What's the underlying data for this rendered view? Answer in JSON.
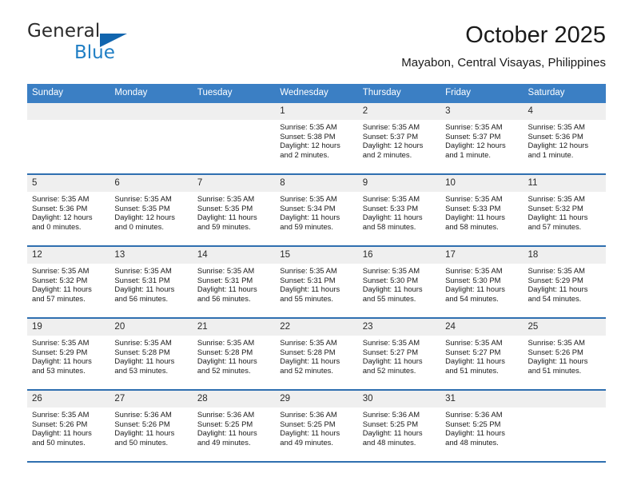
{
  "logo": {
    "word1": "General",
    "word2": "Blue",
    "triangle_color": "#1165ae",
    "blue_color": "#1f7ec4"
  },
  "header": {
    "title": "October 2025",
    "subtitle": "Mayabon, Central Visayas, Philippines"
  },
  "theme": {
    "header_blue": "#3b7fc4",
    "row_divider_blue": "#2f6fb0",
    "date_band_gray": "#efefef"
  },
  "weekdays": [
    "Sunday",
    "Monday",
    "Tuesday",
    "Wednesday",
    "Thursday",
    "Friday",
    "Saturday"
  ],
  "weeks": [
    [
      {
        "day": "",
        "lines": []
      },
      {
        "day": "",
        "lines": []
      },
      {
        "day": "",
        "lines": []
      },
      {
        "day": "1",
        "lines": [
          "Sunrise: 5:35 AM",
          "Sunset: 5:38 PM",
          "Daylight: 12 hours",
          "and 2 minutes."
        ]
      },
      {
        "day": "2",
        "lines": [
          "Sunrise: 5:35 AM",
          "Sunset: 5:37 PM",
          "Daylight: 12 hours",
          "and 2 minutes."
        ]
      },
      {
        "day": "3",
        "lines": [
          "Sunrise: 5:35 AM",
          "Sunset: 5:37 PM",
          "Daylight: 12 hours",
          "and 1 minute."
        ]
      },
      {
        "day": "4",
        "lines": [
          "Sunrise: 5:35 AM",
          "Sunset: 5:36 PM",
          "Daylight: 12 hours",
          "and 1 minute."
        ]
      }
    ],
    [
      {
        "day": "5",
        "lines": [
          "Sunrise: 5:35 AM",
          "Sunset: 5:36 PM",
          "Daylight: 12 hours",
          "and 0 minutes."
        ]
      },
      {
        "day": "6",
        "lines": [
          "Sunrise: 5:35 AM",
          "Sunset: 5:35 PM",
          "Daylight: 12 hours",
          "and 0 minutes."
        ]
      },
      {
        "day": "7",
        "lines": [
          "Sunrise: 5:35 AM",
          "Sunset: 5:35 PM",
          "Daylight: 11 hours",
          "and 59 minutes."
        ]
      },
      {
        "day": "8",
        "lines": [
          "Sunrise: 5:35 AM",
          "Sunset: 5:34 PM",
          "Daylight: 11 hours",
          "and 59 minutes."
        ]
      },
      {
        "day": "9",
        "lines": [
          "Sunrise: 5:35 AM",
          "Sunset: 5:33 PM",
          "Daylight: 11 hours",
          "and 58 minutes."
        ]
      },
      {
        "day": "10",
        "lines": [
          "Sunrise: 5:35 AM",
          "Sunset: 5:33 PM",
          "Daylight: 11 hours",
          "and 58 minutes."
        ]
      },
      {
        "day": "11",
        "lines": [
          "Sunrise: 5:35 AM",
          "Sunset: 5:32 PM",
          "Daylight: 11 hours",
          "and 57 minutes."
        ]
      }
    ],
    [
      {
        "day": "12",
        "lines": [
          "Sunrise: 5:35 AM",
          "Sunset: 5:32 PM",
          "Daylight: 11 hours",
          "and 57 minutes."
        ]
      },
      {
        "day": "13",
        "lines": [
          "Sunrise: 5:35 AM",
          "Sunset: 5:31 PM",
          "Daylight: 11 hours",
          "and 56 minutes."
        ]
      },
      {
        "day": "14",
        "lines": [
          "Sunrise: 5:35 AM",
          "Sunset: 5:31 PM",
          "Daylight: 11 hours",
          "and 56 minutes."
        ]
      },
      {
        "day": "15",
        "lines": [
          "Sunrise: 5:35 AM",
          "Sunset: 5:31 PM",
          "Daylight: 11 hours",
          "and 55 minutes."
        ]
      },
      {
        "day": "16",
        "lines": [
          "Sunrise: 5:35 AM",
          "Sunset: 5:30 PM",
          "Daylight: 11 hours",
          "and 55 minutes."
        ]
      },
      {
        "day": "17",
        "lines": [
          "Sunrise: 5:35 AM",
          "Sunset: 5:30 PM",
          "Daylight: 11 hours",
          "and 54 minutes."
        ]
      },
      {
        "day": "18",
        "lines": [
          "Sunrise: 5:35 AM",
          "Sunset: 5:29 PM",
          "Daylight: 11 hours",
          "and 54 minutes."
        ]
      }
    ],
    [
      {
        "day": "19",
        "lines": [
          "Sunrise: 5:35 AM",
          "Sunset: 5:29 PM",
          "Daylight: 11 hours",
          "and 53 minutes."
        ]
      },
      {
        "day": "20",
        "lines": [
          "Sunrise: 5:35 AM",
          "Sunset: 5:28 PM",
          "Daylight: 11 hours",
          "and 53 minutes."
        ]
      },
      {
        "day": "21",
        "lines": [
          "Sunrise: 5:35 AM",
          "Sunset: 5:28 PM",
          "Daylight: 11 hours",
          "and 52 minutes."
        ]
      },
      {
        "day": "22",
        "lines": [
          "Sunrise: 5:35 AM",
          "Sunset: 5:28 PM",
          "Daylight: 11 hours",
          "and 52 minutes."
        ]
      },
      {
        "day": "23",
        "lines": [
          "Sunrise: 5:35 AM",
          "Sunset: 5:27 PM",
          "Daylight: 11 hours",
          "and 52 minutes."
        ]
      },
      {
        "day": "24",
        "lines": [
          "Sunrise: 5:35 AM",
          "Sunset: 5:27 PM",
          "Daylight: 11 hours",
          "and 51 minutes."
        ]
      },
      {
        "day": "25",
        "lines": [
          "Sunrise: 5:35 AM",
          "Sunset: 5:26 PM",
          "Daylight: 11 hours",
          "and 51 minutes."
        ]
      }
    ],
    [
      {
        "day": "26",
        "lines": [
          "Sunrise: 5:35 AM",
          "Sunset: 5:26 PM",
          "Daylight: 11 hours",
          "and 50 minutes."
        ]
      },
      {
        "day": "27",
        "lines": [
          "Sunrise: 5:36 AM",
          "Sunset: 5:26 PM",
          "Daylight: 11 hours",
          "and 50 minutes."
        ]
      },
      {
        "day": "28",
        "lines": [
          "Sunrise: 5:36 AM",
          "Sunset: 5:25 PM",
          "Daylight: 11 hours",
          "and 49 minutes."
        ]
      },
      {
        "day": "29",
        "lines": [
          "Sunrise: 5:36 AM",
          "Sunset: 5:25 PM",
          "Daylight: 11 hours",
          "and 49 minutes."
        ]
      },
      {
        "day": "30",
        "lines": [
          "Sunrise: 5:36 AM",
          "Sunset: 5:25 PM",
          "Daylight: 11 hours",
          "and 48 minutes."
        ]
      },
      {
        "day": "31",
        "lines": [
          "Sunrise: 5:36 AM",
          "Sunset: 5:25 PM",
          "Daylight: 11 hours",
          "and 48 minutes."
        ]
      },
      {
        "day": "",
        "lines": []
      }
    ]
  ]
}
